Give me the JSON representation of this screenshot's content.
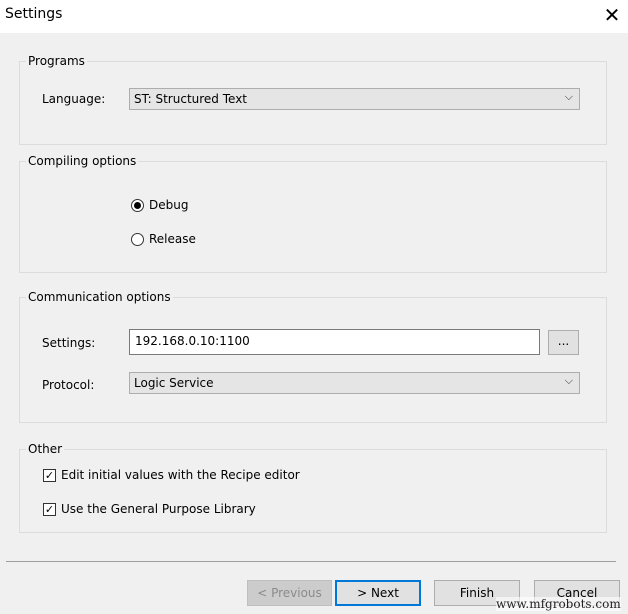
{
  "window": {
    "title": "Settings",
    "close_icon": "close-icon"
  },
  "programs": {
    "legend": "Programs",
    "language_label": "Language:",
    "language_value": "ST: Structured Text"
  },
  "compiling": {
    "legend": "Compiling options",
    "options": [
      {
        "label": "Debug",
        "selected": true
      },
      {
        "label": "Release",
        "selected": false
      }
    ]
  },
  "communication": {
    "legend": "Communication options",
    "settings_label": "Settings:",
    "settings_value": "192.168.0.10:1100",
    "browse_label": "...",
    "protocol_label": "Protocol:",
    "protocol_value": "Logic Service"
  },
  "other": {
    "legend": "Other",
    "checks": [
      {
        "label": "Edit initial values with the Recipe editor",
        "checked": true
      },
      {
        "label": "Use the General Purpose Library",
        "checked": true
      }
    ]
  },
  "footer": {
    "previous": "< Previous",
    "next": "> Next",
    "finish": "Finish",
    "cancel": "Cancel"
  },
  "watermark": "www.mfgrobots.com"
}
